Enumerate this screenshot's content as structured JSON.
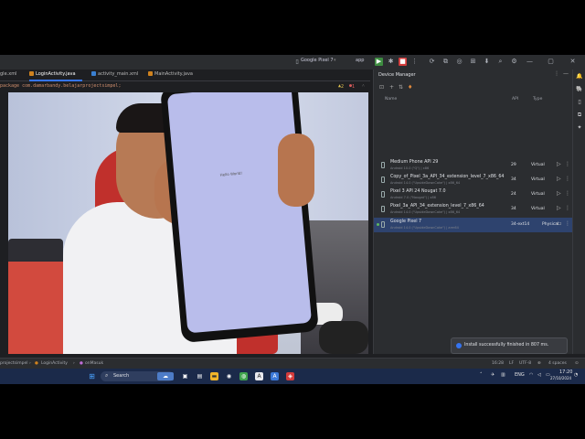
{
  "toolbar": {
    "device": "Google Pixel 7",
    "app": "app"
  },
  "tabs": [
    {
      "label": "gle.xml"
    },
    {
      "label": "LoginActivity.java"
    },
    {
      "label": "activity_main.xml"
    },
    {
      "label": "MainActivity.java"
    }
  ],
  "editor": {
    "package_line": "package com.damarbandy.belajarprojectsimpel;",
    "warnings": "2",
    "errors": "1",
    "gutter_num": "1"
  },
  "phone_screen": {
    "label": "Hello World!"
  },
  "device_manager": {
    "title": "Device Manager",
    "columns": {
      "name": "Name",
      "api": "API",
      "type": "Type"
    },
    "devices": [
      {
        "name": "Medium Phone API 29",
        "sub": "Android 10.0 (\"Q\") | x86",
        "api": "29",
        "type": "Virtual"
      },
      {
        "name": "Copy_of_Pixel_3a_API_34_extension_level_7_x86_64",
        "sub": "Android 14.0 (\"UpsideDownCake\") | x86_64",
        "api": "34",
        "type": "Virtual"
      },
      {
        "name": "Pixel 3 API 24 Nougat 7.0",
        "sub": "Android 7.0 (\"Nougat\") | x86",
        "api": "24",
        "type": "Virtual"
      },
      {
        "name": "Pixel_3a_API_34_extension_level_7_x86_64",
        "sub": "Android 14.0 (\"UpsideDownCake\") | x86_64",
        "api": "34",
        "type": "Virtual"
      },
      {
        "name": "Google Pixel 7",
        "sub": "Android 14.0 (\"UpsideDownCake\") | arm64",
        "api": "34-ext14",
        "type": "Physical"
      }
    ]
  },
  "notification": {
    "text": "Install successfully finished in 807 ms."
  },
  "statusbar": {
    "path": "projectsimpel",
    "file": "LoginActivity",
    "method": "onMasuk",
    "position": "16:28",
    "line_sep": "LF",
    "encoding": "UTF-8",
    "indent": "4 spaces"
  },
  "taskbar": {
    "search": "Search",
    "lang": "ENG",
    "time": "17:20",
    "date": "27/10/2024"
  }
}
